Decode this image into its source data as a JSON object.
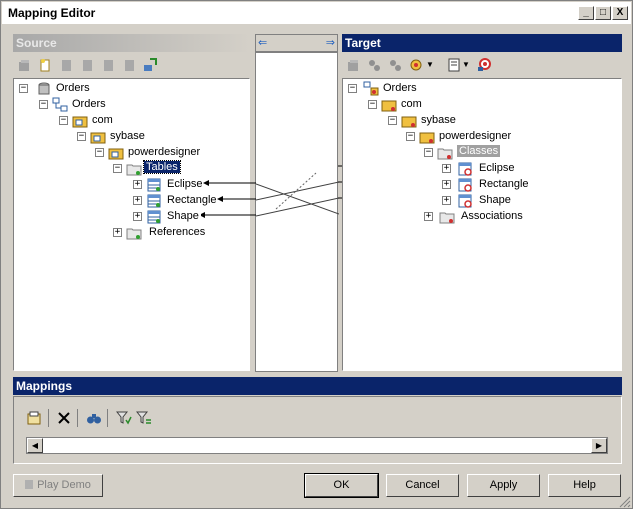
{
  "window": {
    "title": "Mapping Editor",
    "controls": {
      "minimize": "_",
      "maximize": "□",
      "close": "X"
    }
  },
  "source": {
    "header": "Source",
    "tree": {
      "root": "Orders",
      "model": "Orders",
      "pkg1": "com",
      "pkg2": "sybase",
      "pkg3": "powerdesigner",
      "folder": "Tables",
      "items": [
        "Eclipse",
        "Rectangle",
        "Shape"
      ],
      "references": "References"
    }
  },
  "target": {
    "header": "Target",
    "tree": {
      "root": "Orders",
      "pkg1": "com",
      "pkg2": "sybase",
      "pkg3": "powerdesigner",
      "folder": "Classes",
      "items": [
        "Eclipse",
        "Rectangle",
        "Shape"
      ],
      "associations": "Associations"
    }
  },
  "mappings": {
    "header": "Mappings"
  },
  "buttons": {
    "play_demo": "Play Demo",
    "ok": "OK",
    "cancel": "Cancel",
    "apply": "Apply",
    "help": "Help"
  },
  "colors": {
    "active_header": "#0a246a",
    "window_bg": "#d4d0c8",
    "tree_bg": "#ffffff"
  }
}
